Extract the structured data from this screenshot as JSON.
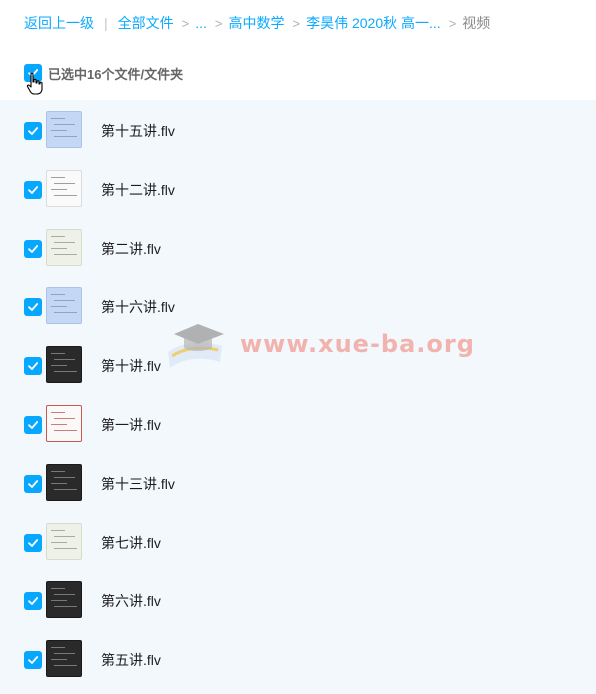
{
  "breadcrumb": {
    "back": "返回上一级",
    "all_files": "全部文件",
    "ellipsis": "...",
    "folder1": "高中数学",
    "folder2": "李昊伟 2020秋 高一...",
    "current": "视频"
  },
  "selection": {
    "summary": "已选中16个文件/文件夹"
  },
  "files": [
    {
      "name": "第十五讲.flv",
      "checked": true,
      "thumb": "light-blue"
    },
    {
      "name": "第十二讲.flv",
      "checked": true,
      "thumb": "white"
    },
    {
      "name": "第二讲.flv",
      "checked": true,
      "thumb": "off-white"
    },
    {
      "name": "第十六讲.flv",
      "checked": true,
      "thumb": "light-blue"
    },
    {
      "name": "第十讲.flv",
      "checked": true,
      "thumb": "dark"
    },
    {
      "name": "第一讲.flv",
      "checked": true,
      "thumb": "white-red"
    },
    {
      "name": "第十三讲.flv",
      "checked": true,
      "thumb": "dark"
    },
    {
      "name": "第七讲.flv",
      "checked": true,
      "thumb": "off-white"
    },
    {
      "name": "第六讲.flv",
      "checked": true,
      "thumb": "dark"
    },
    {
      "name": "第五讲.flv",
      "checked": true,
      "thumb": "dark"
    }
  ],
  "watermark": {
    "text": "www.xue-ba.org"
  },
  "colors": {
    "accent": "#06a7ff",
    "list_bg": "#f3f8fd",
    "watermark": "#f0786e"
  }
}
